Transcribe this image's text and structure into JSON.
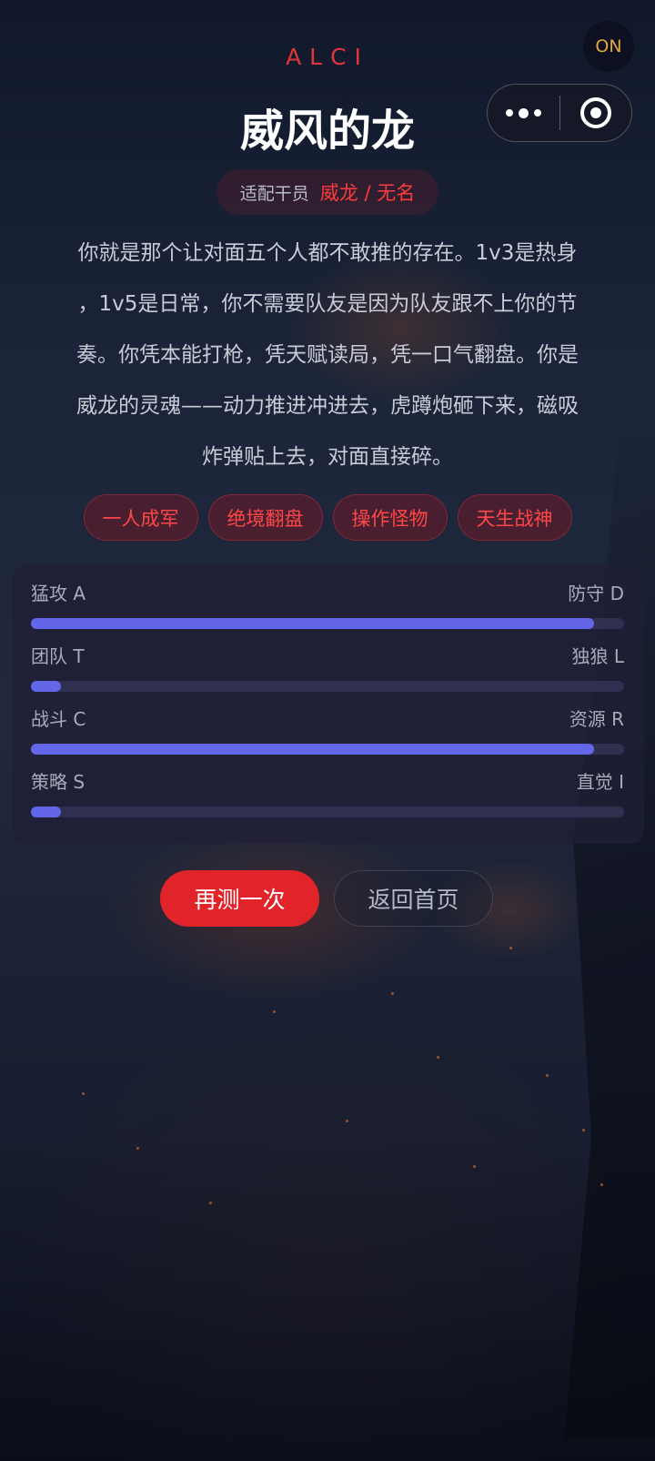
{
  "status": {
    "on_label": "ON"
  },
  "capsule": {
    "more_icon": "more-dots-icon",
    "close_icon": "target-circle-icon"
  },
  "header": {
    "brand": "ALCI",
    "title": "威风的龙",
    "fit_label": "适配干员",
    "fit_value": "威龙 / 无名"
  },
  "description": {
    "lines": [
      "你就是那个让对面五个人都不敢推的存在。1v3是热身",
      "，1v5是日常，你不需要队友是因为队友跟不上你的节",
      "奏。你凭本能打枪，凭天赋读局，凭一口气翻盘。你是",
      "威龙的灵魂——动力推进冲进去，虎蹲炮砸下来，磁吸",
      "炸弹贴上去，对面直接碎。"
    ]
  },
  "tags": [
    "一人成军",
    "绝境翻盘",
    "操作怪物",
    "天生战神"
  ],
  "axes": [
    {
      "left": "猛攻 A",
      "right": "防守 D",
      "value": 0.95
    },
    {
      "left": "团队 T",
      "right": "独狼 L",
      "value": 0.05
    },
    {
      "left": "战斗 C",
      "right": "资源 R",
      "value": 0.95
    },
    {
      "left": "策略 S",
      "right": "直觉 I",
      "value": 0.05
    }
  ],
  "actions": {
    "retry": "再测一次",
    "home": "返回首页"
  },
  "colors": {
    "accent": "#e0242a",
    "bar_fill": "#6466ea",
    "title_red": "#e0353a",
    "on_badge": "#e3a73a"
  }
}
